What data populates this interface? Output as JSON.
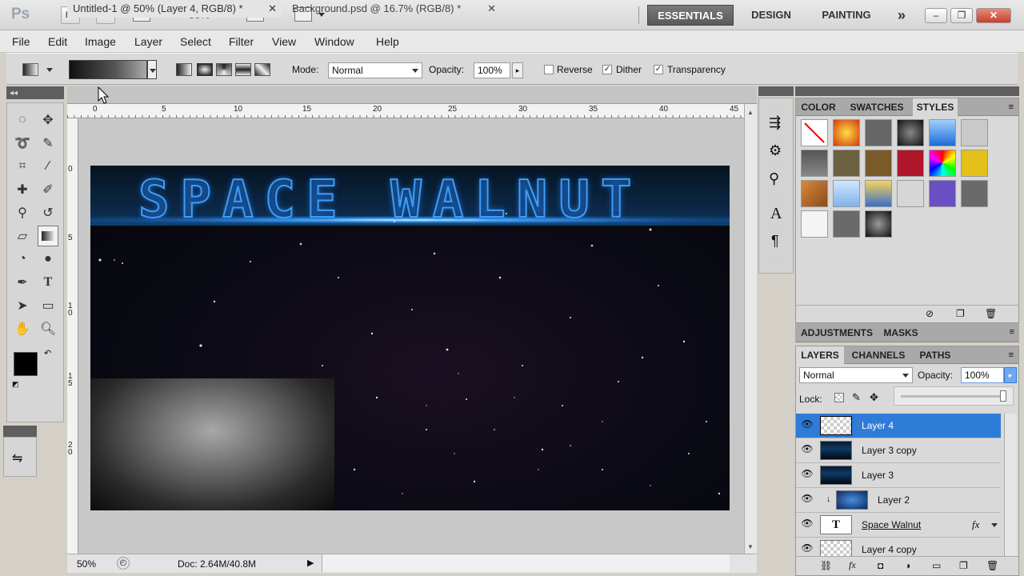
{
  "app": {
    "logo": "Ps",
    "bridge_label": "Br",
    "minibridge_label": "Mb",
    "zoom_value": "50%",
    "workspaces": [
      "ESSENTIALS",
      "DESIGN",
      "PAINTING"
    ],
    "more_workspaces": "»"
  },
  "menu": [
    "File",
    "Edit",
    "Image",
    "Layer",
    "Select",
    "Filter",
    "View",
    "Window",
    "Help"
  ],
  "options": {
    "mode_label": "Mode:",
    "mode_value": "Normal",
    "opacity_label": "Opacity:",
    "opacity_value": "100%",
    "reverse_label": "Reverse",
    "dither_label": "Dither",
    "transparency_label": "Transparency",
    "reverse_checked": false,
    "dither_checked": true,
    "transparency_checked": true
  },
  "documents": {
    "tab1": "Untitled-1 @ 50% (Layer 4, RGB/8) *",
    "tab2": "Background.psd @ 16.7% (RGB/8) *",
    "canvas_title": "SPACE WALNUT",
    "ruler_top": [
      "0",
      "5",
      "10",
      "15",
      "20",
      "25",
      "30",
      "35",
      "40",
      "45"
    ],
    "ruler_left": [
      "0",
      "5",
      "1 0",
      "1 5",
      "2 0"
    ]
  },
  "status": {
    "zoom": "50%",
    "doc_info": "Doc: 2.64M/40.8M"
  },
  "panels": {
    "color_tab": "COLOR",
    "swatches_tab": "SWATCHES",
    "styles_tab": "STYLES",
    "adjustments_tab": "ADJUSTMENTS",
    "masks_tab": "MASKS",
    "layers_tab": "LAYERS",
    "channels_tab": "CHANNELS",
    "paths_tab": "PATHS"
  },
  "layers": {
    "blend_mode": "Normal",
    "opacity_label": "Opacity:",
    "opacity_value": "100%",
    "lock_label": "Lock:",
    "items": [
      {
        "name": "Layer 4",
        "selected": true
      },
      {
        "name": "Layer 3 copy",
        "selected": false
      },
      {
        "name": "Layer 3",
        "selected": false
      },
      {
        "name": "Layer 2",
        "selected": false
      },
      {
        "name": "Space Walnut",
        "selected": false
      },
      {
        "name": "Layer 4 copy",
        "selected": false
      }
    ]
  },
  "colors": {
    "foreground": "#000000",
    "background": "#ffffff",
    "selection": "#2f7bd8",
    "accent_glow": "#3f9cf7"
  }
}
